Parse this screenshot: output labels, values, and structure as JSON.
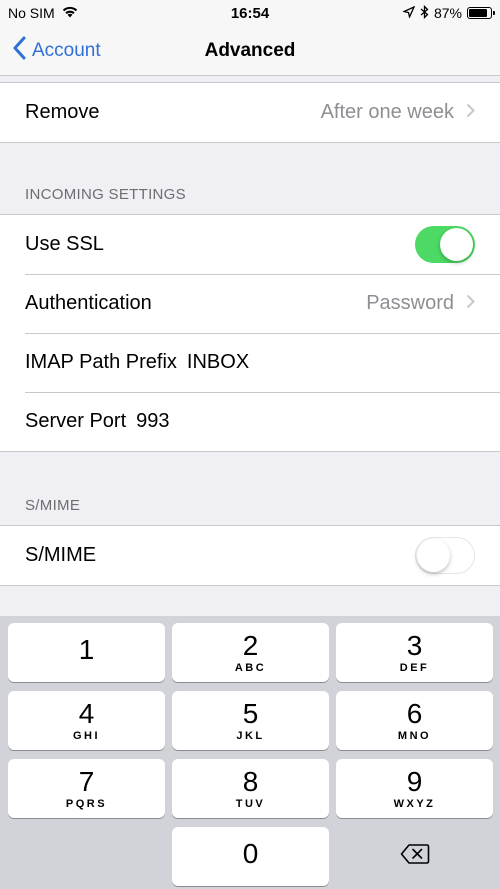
{
  "status_bar": {
    "carrier": "No SIM",
    "time": "16:54",
    "battery": "87%",
    "battery_level": 0.87
  },
  "nav": {
    "back_label": "Account",
    "title": "Advanced"
  },
  "remove_row": {
    "label": "Remove",
    "value": "After one week"
  },
  "incoming": {
    "header": "INCOMING SETTINGS",
    "use_ssl_label": "Use SSL",
    "use_ssl_on": true,
    "auth_label": "Authentication",
    "auth_value": "Password",
    "imap_label": "IMAP Path Prefix",
    "imap_value": "INBOX",
    "port_label": "Server Port",
    "port_value": "993"
  },
  "smime": {
    "header": "S/MIME",
    "label": "S/MIME",
    "on": false
  },
  "keyboard": {
    "keys": [
      {
        "digit": "1",
        "letters": ""
      },
      {
        "digit": "2",
        "letters": "ABC"
      },
      {
        "digit": "3",
        "letters": "DEF"
      },
      {
        "digit": "4",
        "letters": "GHI"
      },
      {
        "digit": "5",
        "letters": "JKL"
      },
      {
        "digit": "6",
        "letters": "MNO"
      },
      {
        "digit": "7",
        "letters": "PQRS"
      },
      {
        "digit": "8",
        "letters": "TUV"
      },
      {
        "digit": "9",
        "letters": "WXYZ"
      },
      {
        "digit": "0",
        "letters": ""
      }
    ]
  },
  "colors": {
    "accent": "#2f6fd6",
    "toggle_on": "#4cd964"
  }
}
